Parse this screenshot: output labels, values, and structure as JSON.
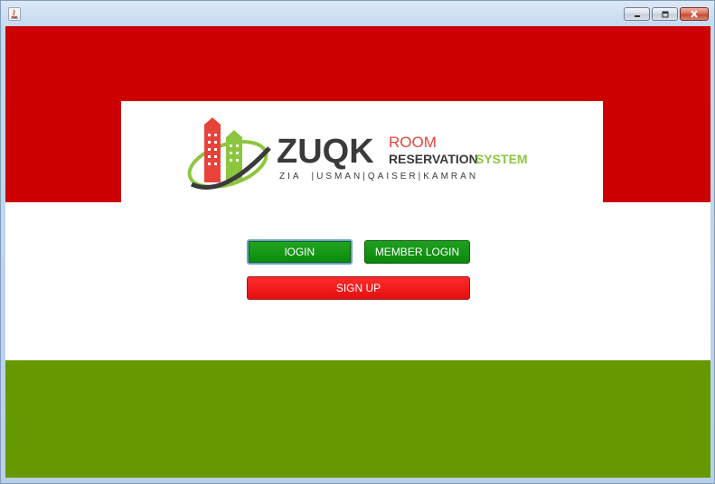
{
  "window": {
    "minimize_label": "Minimize",
    "maximize_label": "Maximize",
    "close_label": "Close"
  },
  "logo": {
    "brand": "ZUQK",
    "line1": "ROOM",
    "line2a": "RESERVATION",
    "line2b": "SYSTEM",
    "members": "ZIA  |USMAN|QAISER|KAMRAN"
  },
  "buttons": {
    "login": "lOGIN",
    "member_login": "MEMBER LOGIN",
    "sign_up": "SIGN UP"
  },
  "colors": {
    "red_band": "#cc0000",
    "green_band": "#669900",
    "login_green": "#0b8a0b",
    "signup_red": "#e41010",
    "logo_red": "#e8433a",
    "logo_green": "#8cc63f",
    "logo_dark": "#3a3a3a"
  }
}
